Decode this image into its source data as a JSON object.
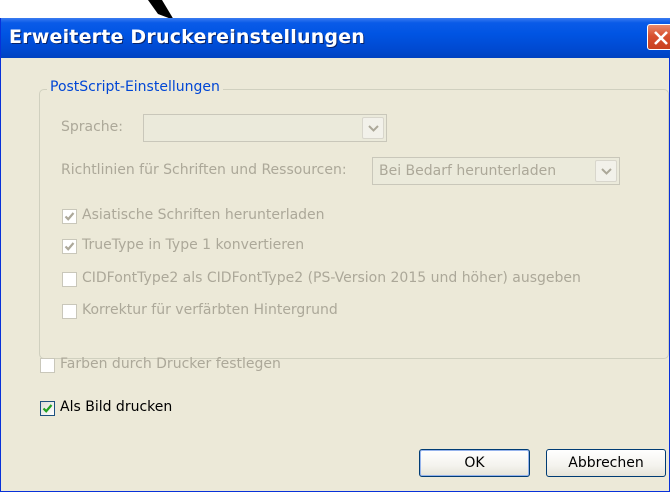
{
  "dialog": {
    "title": "Erweiterte Druckereinstellungen"
  },
  "postscript": {
    "legend": "PostScript-Einstellungen",
    "sprache_label": "Sprache:",
    "sprache_value": "",
    "richtlinien_label": "Richtlinien für Schriften und Ressourcen:",
    "richtlinien_value": "Bei Bedarf herunterladen",
    "options": [
      {
        "label": "Asiatische Schriften herunterladen",
        "checked": true,
        "enabled": false
      },
      {
        "label": "TrueType in Type 1 konvertieren",
        "checked": true,
        "enabled": false
      },
      {
        "label": "CIDFontType2 als CIDFontType2 (PS-Version 2015 und höher) ausgeben",
        "checked": false,
        "enabled": false
      },
      {
        "label": "Korrektur für verfärbten Hintergrund",
        "checked": false,
        "enabled": false
      }
    ]
  },
  "farben": {
    "label": "Farben durch Drucker festlegen",
    "checked": false,
    "enabled": false
  },
  "als_bild": {
    "label": "Als Bild drucken",
    "checked": true,
    "enabled": true
  },
  "buttons": {
    "ok": "OK",
    "cancel": "Abbrechen"
  },
  "colors": {
    "titlebar": "#0054e3",
    "dialog_bg": "#ece9d8",
    "legend_text": "#0046d5",
    "disabled_text": "#aca899",
    "close_button": "#d8502f"
  },
  "icons": {
    "close": "close-icon",
    "dropdown": "chevron-down-icon",
    "check": "checkmark-icon",
    "pointer": "arrow-pointer-icon"
  }
}
